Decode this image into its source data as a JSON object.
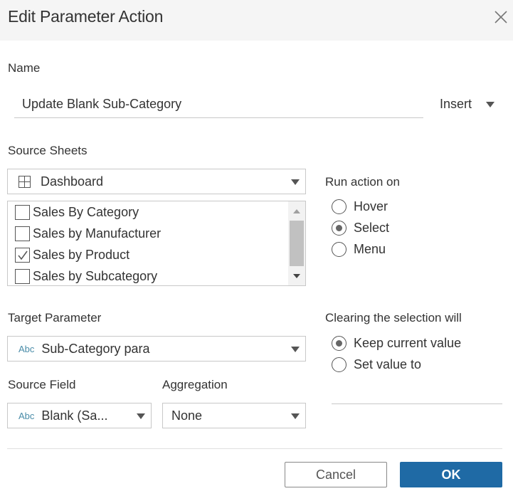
{
  "dialog": {
    "title": "Edit Parameter Action",
    "close_icon": "close-icon"
  },
  "name_section": {
    "label": "Name",
    "value": "Update Blank Sub-Category",
    "insert_label": "Insert"
  },
  "source_sheets": {
    "label": "Source Sheets",
    "selected": "Dashboard",
    "icon": "dashboard-grid-icon",
    "items": [
      {
        "label": "Sales By Category",
        "checked": false
      },
      {
        "label": "Sales by Manufacturer",
        "checked": false
      },
      {
        "label": "Sales by Product",
        "checked": true
      },
      {
        "label": "Sales by Subcategory",
        "checked": false
      }
    ]
  },
  "run_action_on": {
    "label": "Run action on",
    "options": [
      {
        "label": "Hover",
        "selected": false
      },
      {
        "label": "Select",
        "selected": true
      },
      {
        "label": "Menu",
        "selected": false
      }
    ]
  },
  "target_parameter": {
    "label": "Target Parameter",
    "type_badge": "Abc",
    "value": "Sub-Category para"
  },
  "clearing": {
    "label": "Clearing the selection will",
    "options": [
      {
        "label": "Keep current value",
        "selected": true
      },
      {
        "label": "Set value to",
        "selected": false
      }
    ],
    "set_value": ""
  },
  "source_field": {
    "label": "Source Field",
    "type_badge": "Abc",
    "value": "Blank (Sa..."
  },
  "aggregation": {
    "label": "Aggregation",
    "value": "None"
  },
  "footer": {
    "cancel_label": "Cancel",
    "ok_label": "OK",
    "ok_color": "#1f6aa5"
  }
}
